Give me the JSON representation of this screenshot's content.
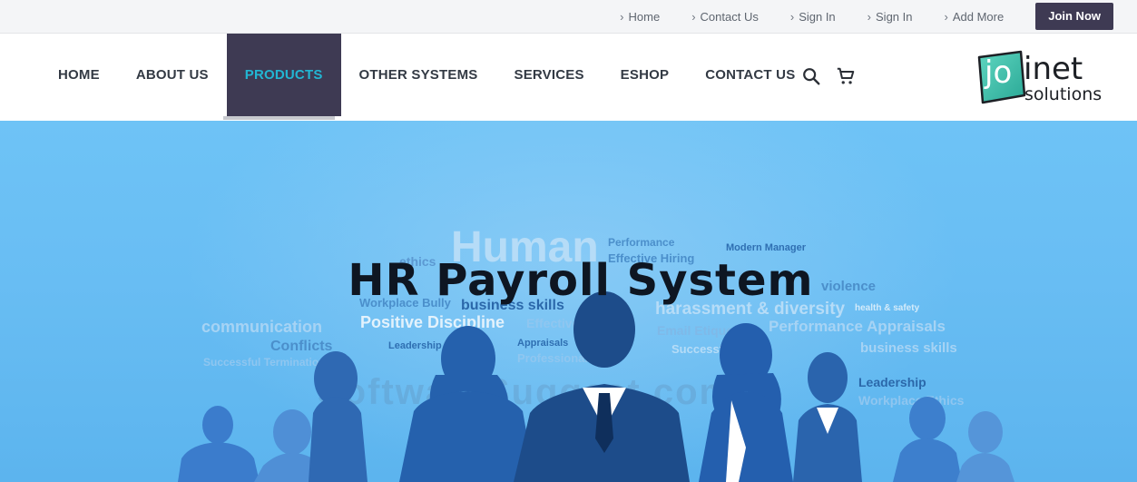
{
  "topbar": {
    "links": [
      {
        "label": "Home"
      },
      {
        "label": "Contact Us"
      },
      {
        "label": "Sign In"
      },
      {
        "label": "Sign In"
      },
      {
        "label": "Add More"
      }
    ],
    "join_label": "Join Now"
  },
  "nav": {
    "items": [
      {
        "label": "HOME"
      },
      {
        "label": "ABOUT US"
      },
      {
        "label": "PRODUCTS",
        "active": true
      },
      {
        "label": "OTHER SYSTEMS"
      },
      {
        "label": "SERVICES"
      },
      {
        "label": "ESHOP"
      },
      {
        "label": "CONTACT US"
      }
    ],
    "icons": [
      "search-icon",
      "cart-icon"
    ]
  },
  "logo": {
    "top": "jo",
    "brand": "inet",
    "sub": "solutions"
  },
  "hero": {
    "title": "HR Payroll System",
    "background_words": [
      "Human",
      "Performance",
      "Effective Hiring",
      "Modern Manager",
      "ethics",
      "Workplace Bully",
      "business skills",
      "harassment & diversity",
      "violence",
      "health & safety",
      "communication",
      "Positive Discipline",
      "Effective",
      "Email Etiquette",
      "Performance Appraisals",
      "Conflicts",
      "Leadership",
      "Appraisals",
      "Successful",
      "business skills",
      "Successful Termination",
      "Professional",
      "Leadership",
      "Workplace Ethics",
      "SoftwareSuggest.com"
    ]
  },
  "colors": {
    "accent": "#22b6d3",
    "nav_active_bg": "#3e3a53",
    "hero_bg": "#68bdf3"
  }
}
